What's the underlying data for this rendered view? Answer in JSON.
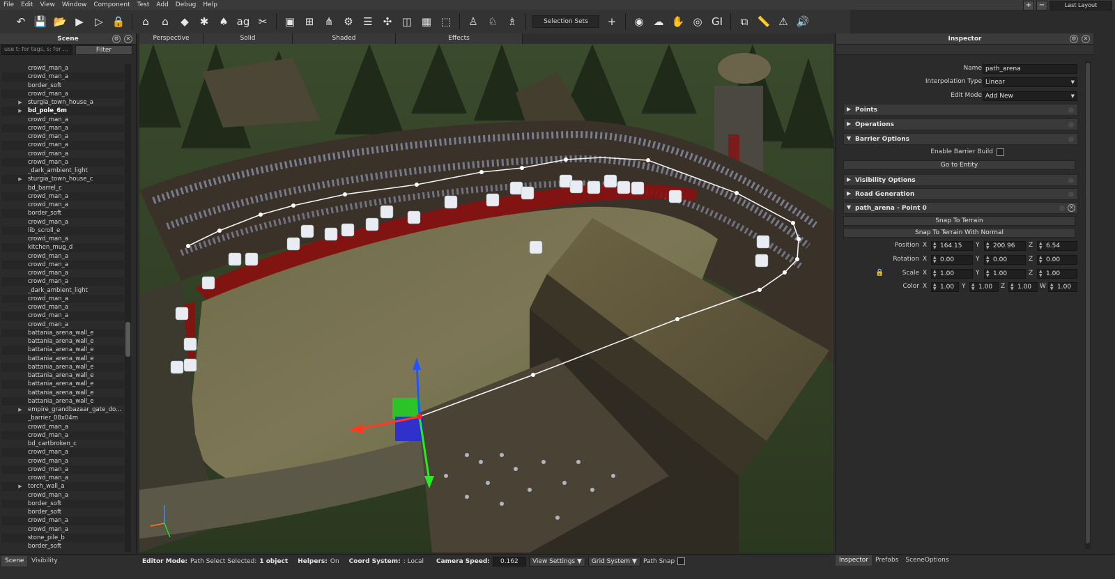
{
  "menu": [
    "File",
    "Edit",
    "View",
    "Window",
    "Component",
    "Test",
    "Add",
    "Debug",
    "Help"
  ],
  "layout": {
    "plus": "+",
    "minus": "−",
    "select": "Last Layout"
  },
  "toolbar": {
    "icons_group1": [
      "undo-icon",
      "save-icon",
      "open-folder-icon",
      "play-icon",
      "play-outline-icon",
      "lock-icon"
    ],
    "icons_group2": [
      "house-icon",
      "house-alt-icon",
      "rock-icon",
      "network-icon",
      "tree-icon",
      "text-ag-icon",
      "scissors-icon"
    ],
    "icons_group3": [
      "cube-icon",
      "cube-add-icon",
      "vertex-icon",
      "cube-settings-icon",
      "layers-icon",
      "puzzle-icon",
      "box-icon",
      "grid-box-icon",
      "wireframe-box-icon"
    ],
    "icons_group4": [
      "person-icon",
      "person-run-icon",
      "person-arrow-icon"
    ],
    "selection_sets": "Selection Sets",
    "add": "+",
    "icons_group5": [
      "camera-layers-icon",
      "cloud-gear-icon",
      "hand-icon",
      "eye-cloud-icon",
      "gi-icon"
    ],
    "icons_group6": [
      "cube-link-icon",
      "ruler-icon",
      "warning-icon",
      "sound-icon"
    ]
  },
  "scene_panel": {
    "title": "Scene",
    "search_placeholder": "use t: for tags, s: for ...",
    "filter": "Filter",
    "items": [
      {
        "name": "crowd_man_a",
        "expand": false,
        "bold": false
      },
      {
        "name": "crowd_man_a",
        "expand": false,
        "bold": false
      },
      {
        "name": "border_soft",
        "expand": false,
        "bold": false
      },
      {
        "name": "crowd_man_a",
        "expand": false,
        "bold": false
      },
      {
        "name": "sturgia_town_house_a",
        "expand": true,
        "bold": false
      },
      {
        "name": "bd_pole_6m",
        "expand": true,
        "bold": true
      },
      {
        "name": "crowd_man_a",
        "expand": false,
        "bold": false
      },
      {
        "name": "crowd_man_a",
        "expand": false,
        "bold": false
      },
      {
        "name": "crowd_man_a",
        "expand": false,
        "bold": false
      },
      {
        "name": "crowd_man_a",
        "expand": false,
        "bold": false
      },
      {
        "name": "crowd_man_a",
        "expand": false,
        "bold": false
      },
      {
        "name": "crowd_man_a",
        "expand": false,
        "bold": false
      },
      {
        "name": "_dark_ambient_light",
        "expand": false,
        "bold": false
      },
      {
        "name": "sturgia_town_house_c",
        "expand": true,
        "bold": false
      },
      {
        "name": "bd_barrel_c",
        "expand": false,
        "bold": false
      },
      {
        "name": "crowd_man_a",
        "expand": false,
        "bold": false
      },
      {
        "name": "crowd_man_a",
        "expand": false,
        "bold": false
      },
      {
        "name": "border_soft",
        "expand": false,
        "bold": false
      },
      {
        "name": "crowd_man_a",
        "expand": false,
        "bold": false
      },
      {
        "name": "lib_scroll_e",
        "expand": false,
        "bold": false
      },
      {
        "name": "crowd_man_a",
        "expand": false,
        "bold": false
      },
      {
        "name": "kitchen_mug_d",
        "expand": false,
        "bold": false
      },
      {
        "name": "crowd_man_a",
        "expand": false,
        "bold": false
      },
      {
        "name": "crowd_man_a",
        "expand": false,
        "bold": false
      },
      {
        "name": "crowd_man_a",
        "expand": false,
        "bold": false
      },
      {
        "name": "crowd_man_a",
        "expand": false,
        "bold": false
      },
      {
        "name": "_dark_ambient_light",
        "expand": false,
        "bold": false
      },
      {
        "name": "crowd_man_a",
        "expand": false,
        "bold": false
      },
      {
        "name": "crowd_man_a",
        "expand": false,
        "bold": false
      },
      {
        "name": "crowd_man_a",
        "expand": false,
        "bold": false
      },
      {
        "name": "crowd_man_a",
        "expand": false,
        "bold": false
      },
      {
        "name": "battania_arena_wall_e",
        "expand": false,
        "bold": false
      },
      {
        "name": "battania_arena_wall_e",
        "expand": false,
        "bold": false
      },
      {
        "name": "battania_arena_wall_e",
        "expand": false,
        "bold": false
      },
      {
        "name": "battania_arena_wall_e",
        "expand": false,
        "bold": false
      },
      {
        "name": "battania_arena_wall_e",
        "expand": false,
        "bold": false
      },
      {
        "name": "battania_arena_wall_e",
        "expand": false,
        "bold": false
      },
      {
        "name": "battania_arena_wall_e",
        "expand": false,
        "bold": false
      },
      {
        "name": "battania_arena_wall_e",
        "expand": false,
        "bold": false
      },
      {
        "name": "battania_arena_wall_e",
        "expand": false,
        "bold": false
      },
      {
        "name": "empire_grandbazaar_gate_do...",
        "expand": true,
        "bold": false
      },
      {
        "name": "_barrier_08x04m",
        "expand": false,
        "bold": false
      },
      {
        "name": "crowd_man_a",
        "expand": false,
        "bold": false
      },
      {
        "name": "crowd_man_a",
        "expand": false,
        "bold": false
      },
      {
        "name": "bd_cartbroken_c",
        "expand": false,
        "bold": false
      },
      {
        "name": "crowd_man_a",
        "expand": false,
        "bold": false
      },
      {
        "name": "crowd_man_a",
        "expand": false,
        "bold": false
      },
      {
        "name": "crowd_man_a",
        "expand": false,
        "bold": false
      },
      {
        "name": "crowd_man_a",
        "expand": false,
        "bold": false
      },
      {
        "name": "torch_wall_a",
        "expand": true,
        "bold": false
      },
      {
        "name": "crowd_man_a",
        "expand": false,
        "bold": false
      },
      {
        "name": "border_soft",
        "expand": false,
        "bold": false
      },
      {
        "name": "border_soft",
        "expand": false,
        "bold": false
      },
      {
        "name": "crowd_man_a",
        "expand": false,
        "bold": false
      },
      {
        "name": "crowd_man_a",
        "expand": false,
        "bold": false
      },
      {
        "name": "stone_pile_b",
        "expand": false,
        "bold": false
      },
      {
        "name": "border_soft",
        "expand": false,
        "bold": false
      }
    ]
  },
  "viewport": {
    "tabs": [
      "Perspective",
      "Solid",
      "Shaded",
      "Effects"
    ]
  },
  "status": {
    "editor_mode_label": "Editor Mode:",
    "editor_mode_value": "Path Select Selected:",
    "selected_count": "1 object",
    "helpers_label": "Helpers:",
    "helpers_value": "On",
    "coord_label": "Coord System:",
    "coord_value": ": Local",
    "camera_speed_label": "Camera Speed:",
    "camera_speed": "0.162",
    "view_settings": "View Settings ▼",
    "grid_system": "Grid System ▼",
    "path_snap": "Path Snap"
  },
  "bottom_tabs_left": [
    "Scene",
    "Visibility"
  ],
  "bottom_tabs_right": [
    "Inspector",
    "Prefabs",
    "SceneOptions"
  ],
  "inspector": {
    "title": "Inspector",
    "name_label": "Name",
    "name_value": "path_arena",
    "interp_label": "Interpolation Type",
    "interp_value": "Linear",
    "edit_mode_label": "Edit Mode",
    "edit_mode_value": "Add New",
    "sections": {
      "points": "Points",
      "operations": "Operations",
      "barrier": "Barrier Options",
      "visibility": "Visibility Options",
      "road": "Road Generation",
      "point0": "path_arena - Point 0"
    },
    "enable_barrier_label": "Enable Barrier Build",
    "go_to_entity": "Go to Entity",
    "snap_terrain": "Snap To Terrain",
    "snap_terrain_normal": "Snap To Terrain With Normal",
    "position": {
      "label": "Position",
      "x": "164.15",
      "y": "200.96",
      "z": "6.54"
    },
    "rotation": {
      "label": "Rotation",
      "x": "0.00",
      "y": "0.00",
      "z": "0.00"
    },
    "scale": {
      "label": "Scale",
      "x": "1.00",
      "y": "1.00",
      "z": "1.00"
    },
    "color": {
      "label": "Color",
      "x": "1.00",
      "y": "1.00",
      "z": "1.00",
      "w": "1.00"
    },
    "axis": {
      "x": "X",
      "y": "Y",
      "z": "Z",
      "w": "W"
    }
  }
}
